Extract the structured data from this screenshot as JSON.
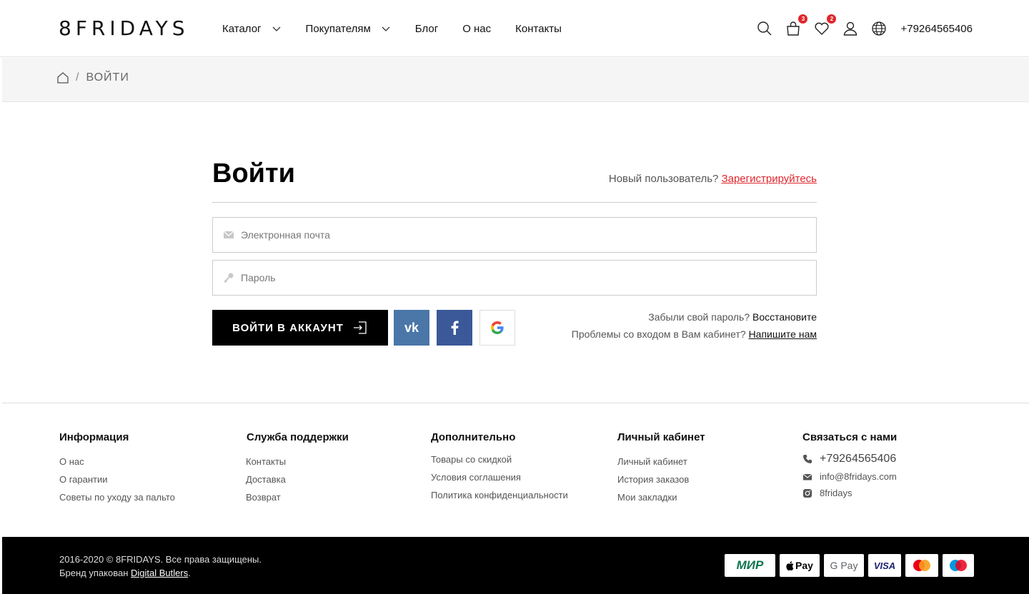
{
  "header": {
    "logo": "8FRIDAYS",
    "nav": [
      {
        "label": "Каталог",
        "dropdown": true
      },
      {
        "label": "Покупателям",
        "dropdown": true
      },
      {
        "label": "Блог",
        "dropdown": false
      },
      {
        "label": "О нас",
        "dropdown": false
      },
      {
        "label": "Контакты",
        "dropdown": false
      }
    ],
    "cart_count": "3",
    "wishlist_count": "2",
    "phone": "+79264565406",
    "icons": [
      "search-icon",
      "cart-icon",
      "heart-icon",
      "user-icon",
      "globe-icon"
    ]
  },
  "breadcrumb": {
    "home_icon": "home-icon",
    "separator": "/",
    "current": "ВОЙТИ"
  },
  "login": {
    "title": "Войти",
    "new_user_text": "Новый пользователь?",
    "register_link": "Зарегистрируйтесь",
    "email_placeholder": "Электронная почта",
    "password_placeholder": "Пароль",
    "submit_label": "ВОЙТИ В АККАУНТ",
    "vk_label": "vk",
    "forgot_text": "Забыли свой пароль?",
    "forgot_link": "Восстановите",
    "problems_text": "Проблемы со входом в Вам кабинет?",
    "problems_link": "Напишите нам"
  },
  "footer": {
    "columns": [
      {
        "title": "Информация",
        "links": [
          "О нас",
          "О гарантии",
          "Советы по уходу за пальто"
        ]
      },
      {
        "title": "Служба поддержки",
        "links": [
          "Контакты",
          "Доставка",
          "Возврат"
        ]
      },
      {
        "title": "Дополнительно",
        "links": [
          "Товары со скидкой",
          "Условия соглашения",
          "Политика конфиденциальности"
        ]
      },
      {
        "title": "Личный кабинет",
        "links": [
          "Личный кабинет",
          "История заказов",
          "Мои закладки"
        ]
      }
    ],
    "contact": {
      "title": "Связаться с нами",
      "phone": "+79264565406",
      "email": "info@8fridays.com",
      "instagram": "8fridays"
    },
    "copyright": "2016-2020 © 8FRIDAYS. Все права защищены.",
    "brand_text": "Бренд упакован",
    "brand_link": "Digital Butlers",
    "brand_end": ".",
    "payments": {
      "mir": "МИР",
      "apple": "Pay",
      "gpay": "G Pay",
      "visa": "VISA"
    }
  },
  "colors": {
    "accent": "#e0262c",
    "vk": "#4a76a8",
    "facebook": "#3b5998",
    "footer_bg": "#000000"
  }
}
